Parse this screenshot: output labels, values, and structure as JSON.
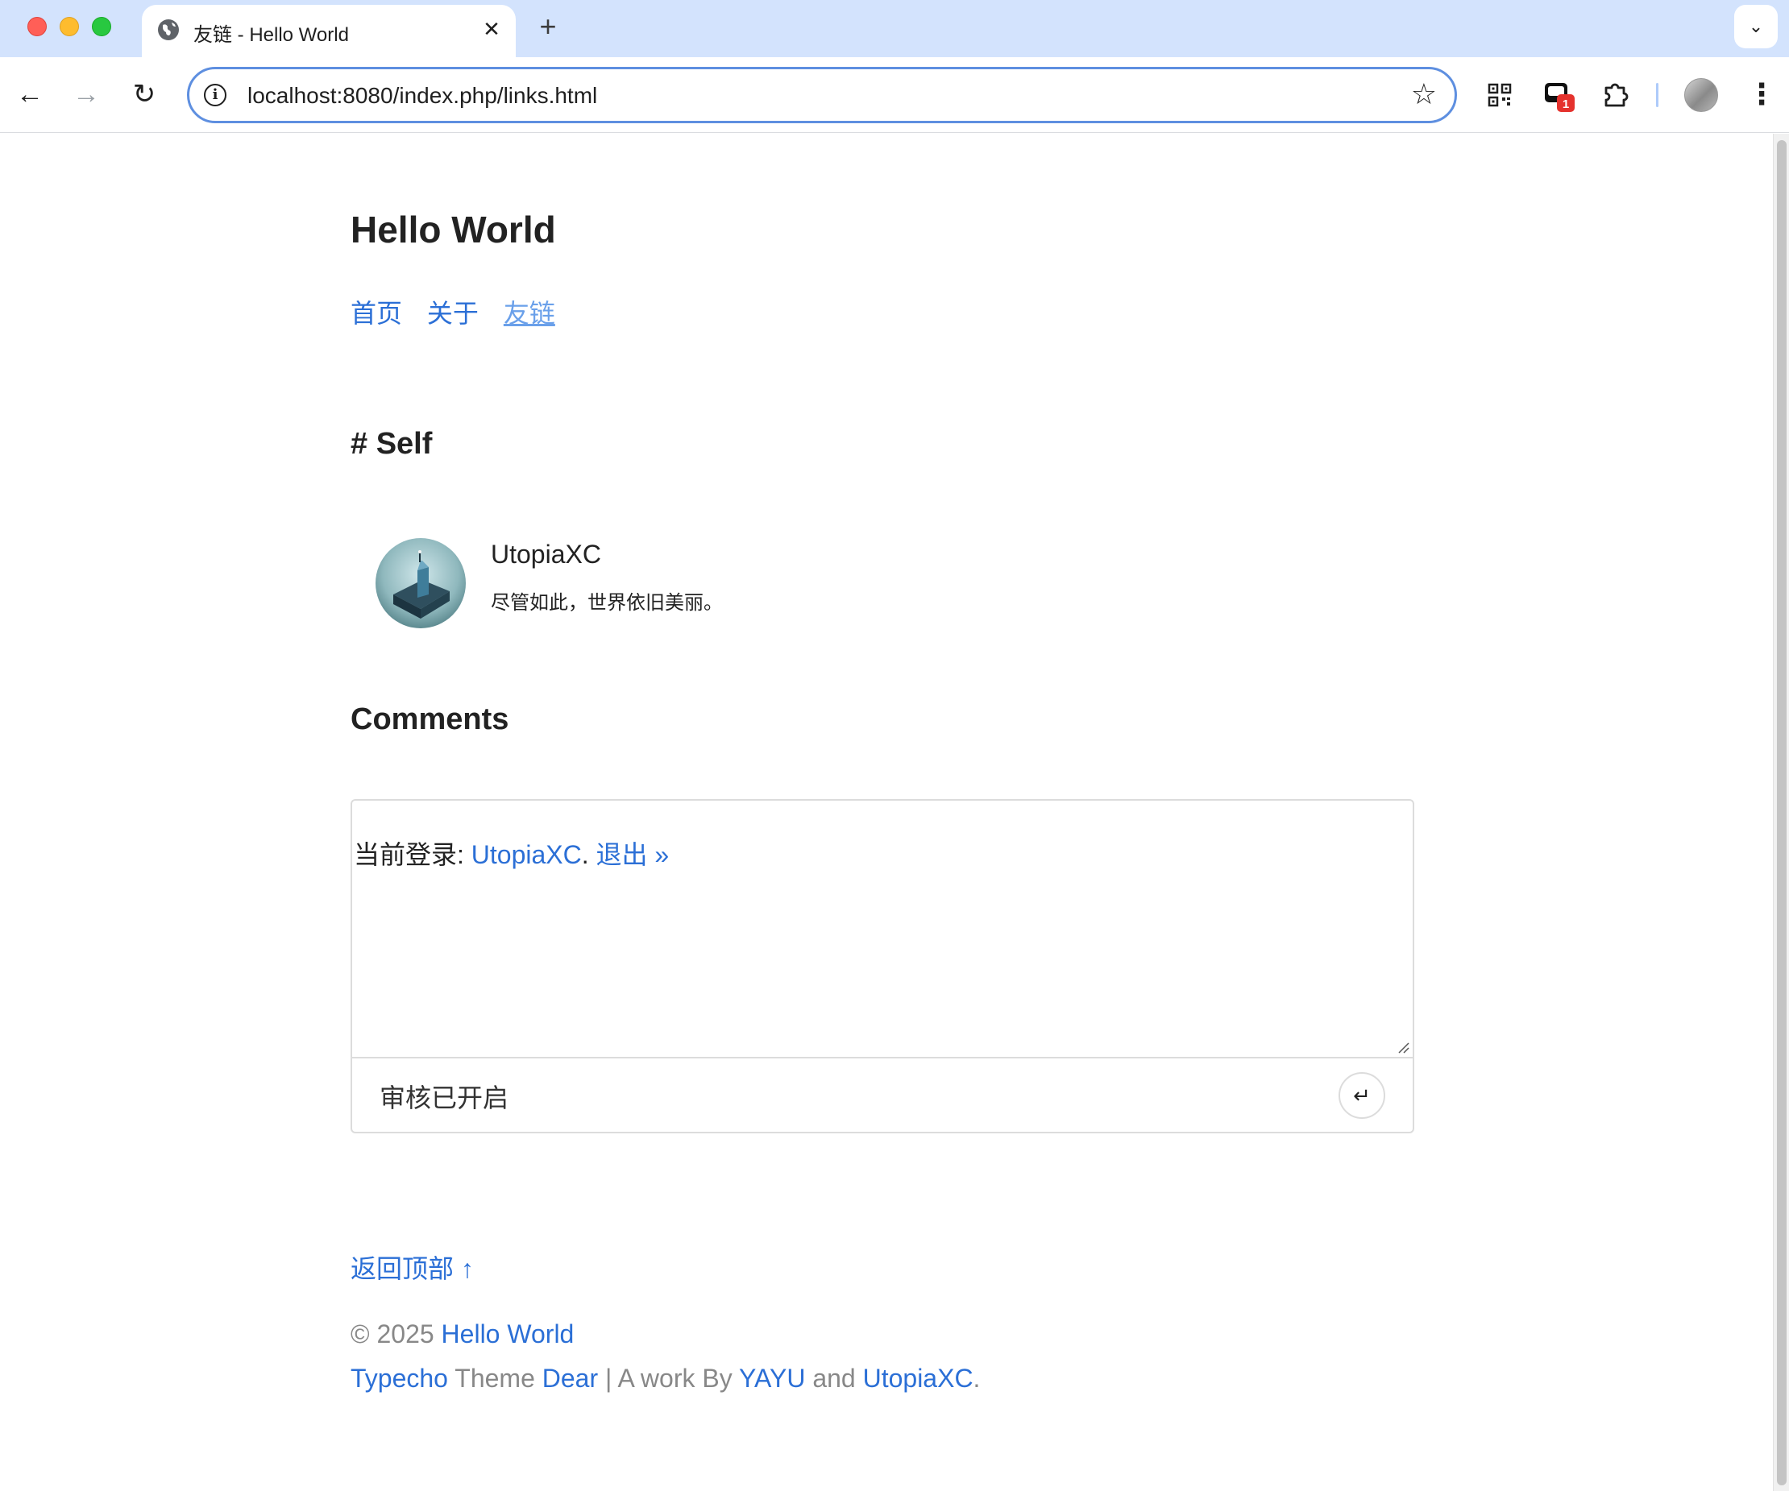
{
  "browser": {
    "tab": {
      "title": "友链 - Hello World",
      "close_label": "✕"
    },
    "new_tab_label": "+",
    "tab_search_label": "⌄",
    "nav": {
      "back_label": "←",
      "forward_label": "→",
      "reload_label": "↻"
    },
    "address_bar": {
      "url": "localhost:8080/index.php/links.html",
      "site_info_label": "i",
      "bookmark_label": "☆"
    },
    "extensions": {
      "badge_count": "1"
    },
    "menu_label": "⋮",
    "colors": {
      "tabstrip": "#d3e3fd",
      "omnibox_border": "#5e8fe0",
      "badge": "#e5322d"
    }
  },
  "page": {
    "site_title": "Hello World",
    "nav_links": [
      {
        "label": "首页",
        "active": false
      },
      {
        "label": "关于",
        "active": false
      },
      {
        "label": "友链",
        "active": true
      }
    ],
    "section_title": "# Self",
    "links": [
      {
        "name": "UtopiaXC",
        "description": "尽管如此，世界依旧美丽。"
      }
    ],
    "comments": {
      "title": "Comments",
      "login_prefix": "当前登录: ",
      "login_user": "UtopiaXC",
      "login_separator": ". ",
      "logout_label": "退出 »",
      "status": "审核已开启",
      "submit_label": "↵"
    },
    "footer": {
      "back_to_top": "返回顶部 ↑",
      "copyright_prefix": "© 2025 ",
      "copyright_site": "Hello World",
      "typecho_link": "Typecho",
      "theme_word": " Theme ",
      "theme_link": "Dear",
      "work_by": " | A work By ",
      "author1": "YAYU",
      "and_word": " and ",
      "author2": "UtopiaXC",
      "end_period": "."
    },
    "colors": {
      "link": "#2b6fd6",
      "active_link": "#6aa0ea",
      "footer_text": "#888888"
    }
  }
}
